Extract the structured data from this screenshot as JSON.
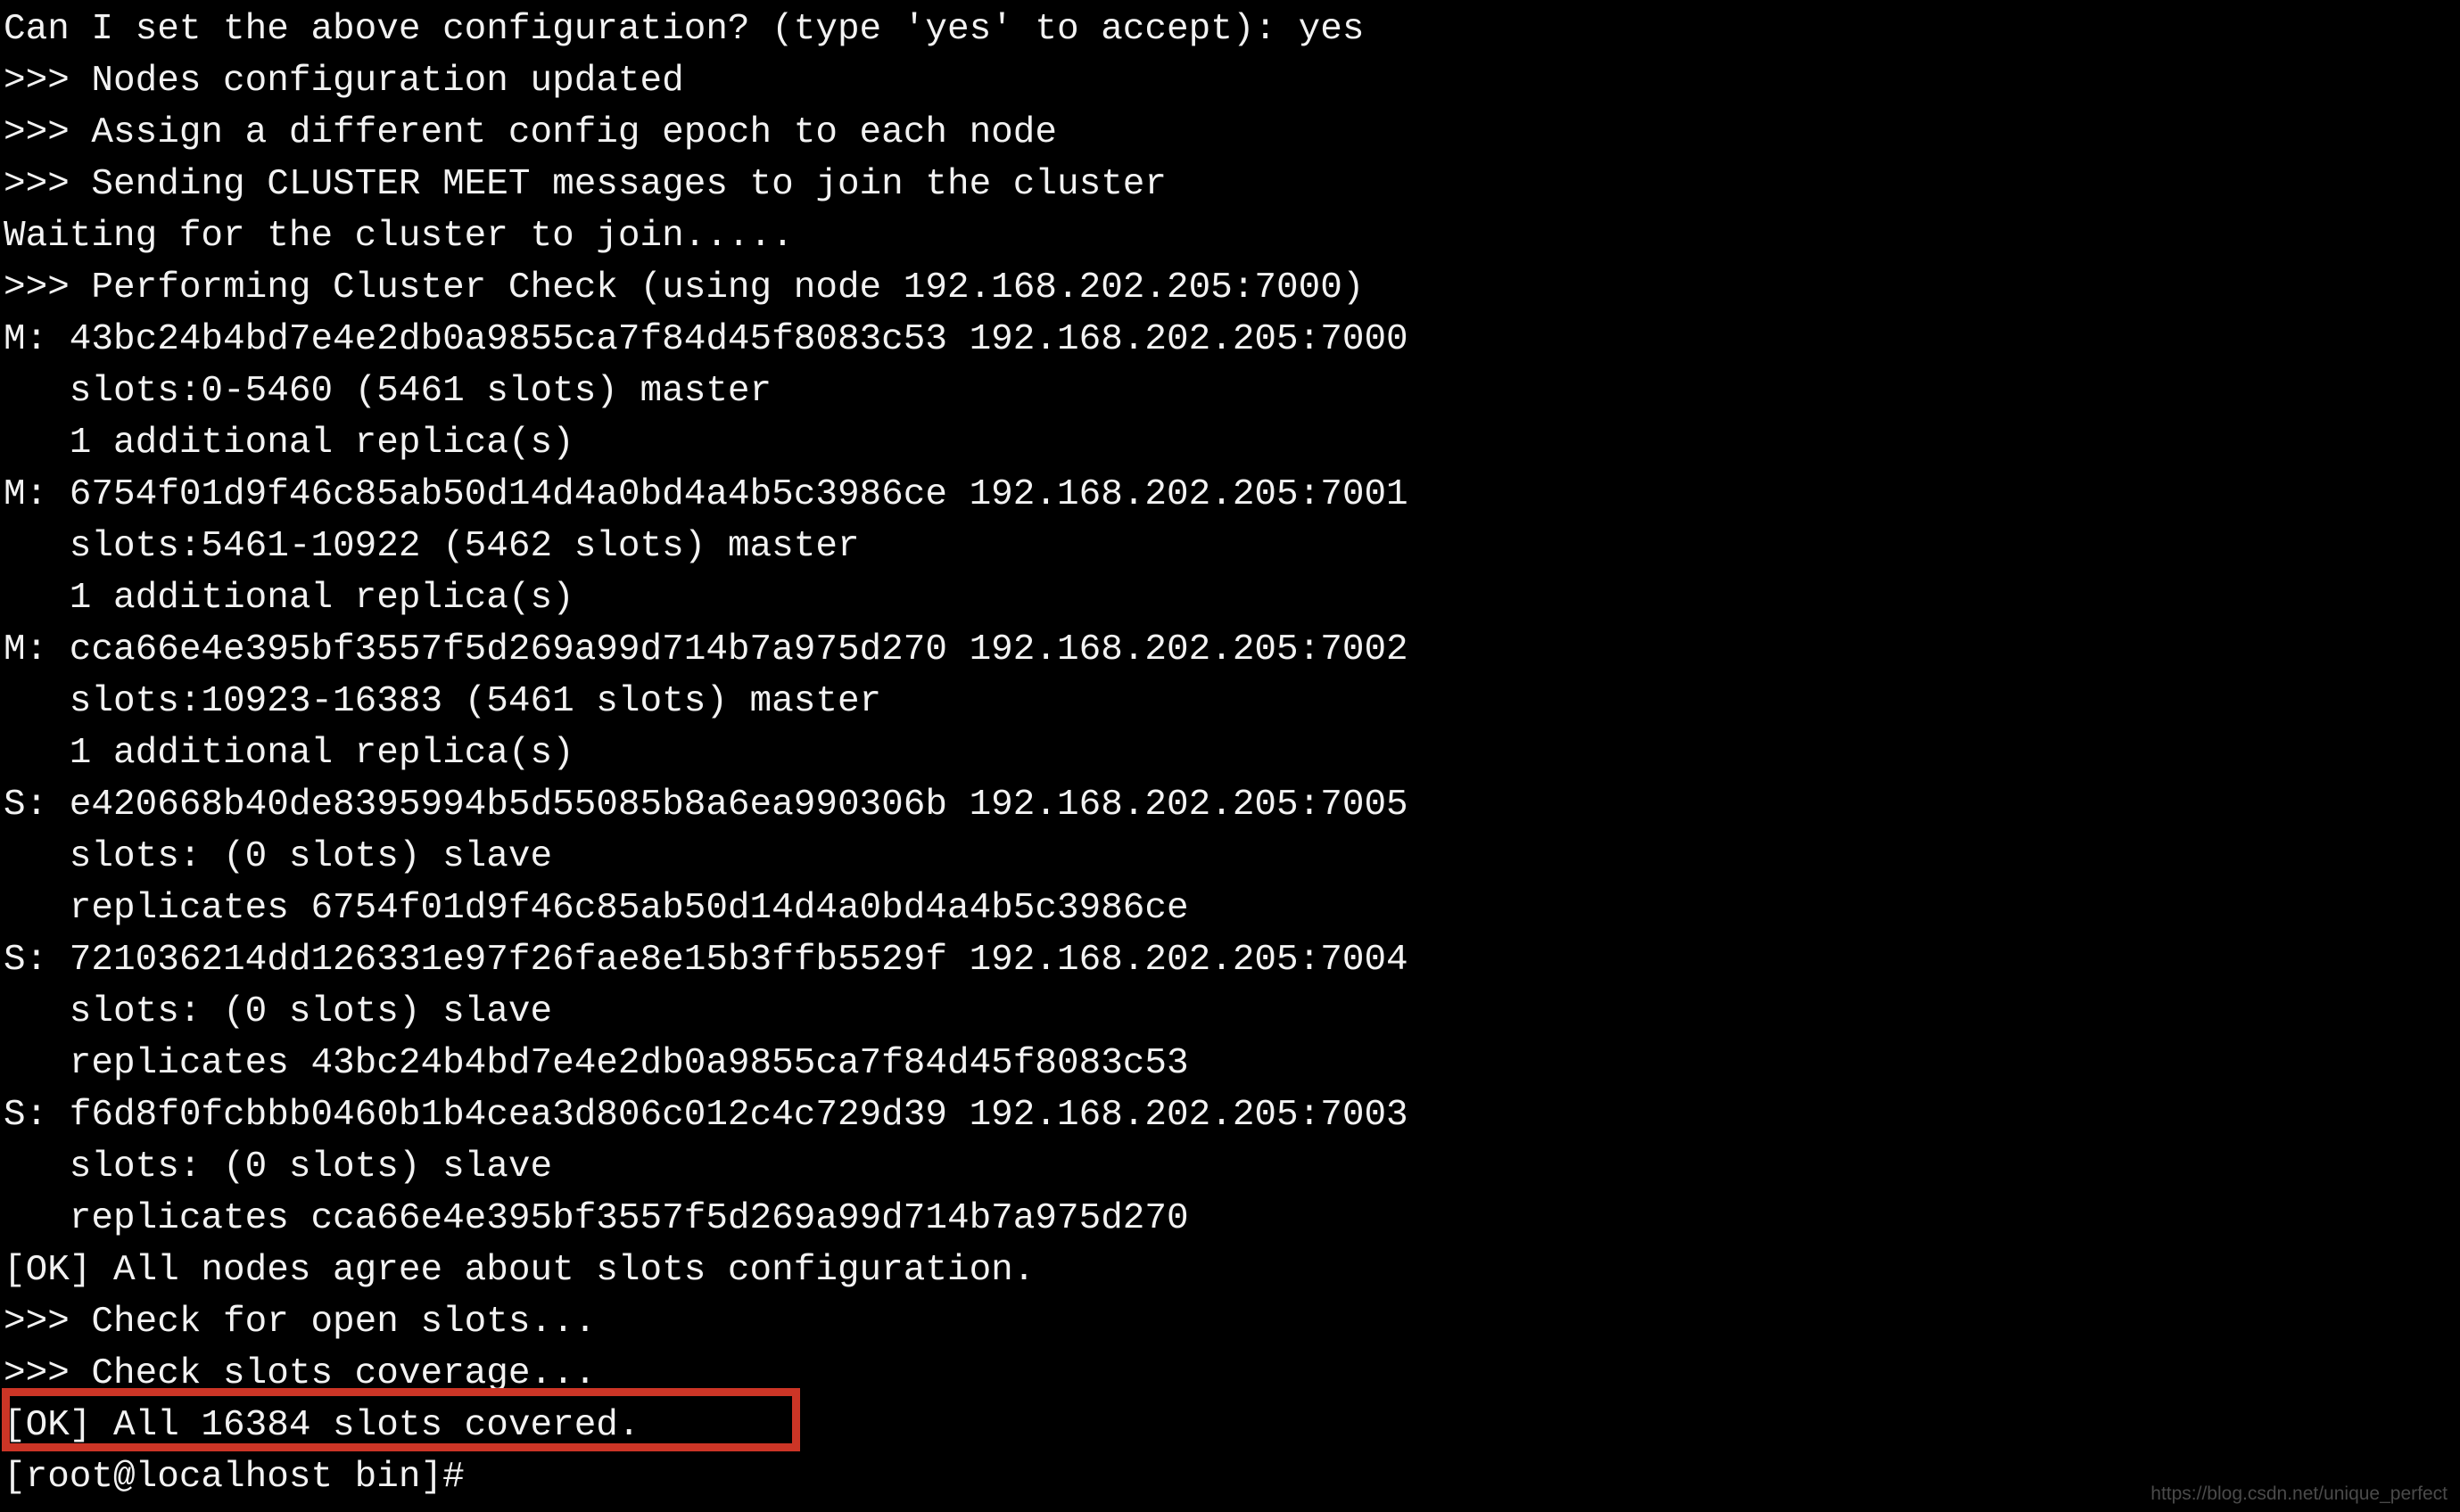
{
  "terminal": {
    "background_color": "#000000",
    "foreground_color": "#f2f2f2",
    "highlight_color": "#cc3526",
    "lines": [
      "Can I set the above configuration? (type 'yes' to accept): yes",
      ">>> Nodes configuration updated",
      ">>> Assign a different config epoch to each node",
      ">>> Sending CLUSTER MEET messages to join the cluster",
      "Waiting for the cluster to join.....",
      ">>> Performing Cluster Check (using node 192.168.202.205:7000)",
      "M: 43bc24b4bd7e4e2db0a9855ca7f84d45f8083c53 192.168.202.205:7000",
      "   slots:0-5460 (5461 slots) master",
      "   1 additional replica(s)",
      "M: 6754f01d9f46c85ab50d14d4a0bd4a4b5c3986ce 192.168.202.205:7001",
      "   slots:5461-10922 (5462 slots) master",
      "   1 additional replica(s)",
      "M: cca66e4e395bf3557f5d269a99d714b7a975d270 192.168.202.205:7002",
      "   slots:10923-16383 (5461 slots) master",
      "   1 additional replica(s)",
      "S: e420668b40de8395994b5d55085b8a6ea990306b 192.168.202.205:7005",
      "   slots: (0 slots) slave",
      "   replicates 6754f01d9f46c85ab50d14d4a0bd4a4b5c3986ce",
      "S: 721036214dd126331e97f26fae8e15b3ffb5529f 192.168.202.205:7004",
      "   slots: (0 slots) slave",
      "   replicates 43bc24b4bd7e4e2db0a9855ca7f84d45f8083c53",
      "S: f6d8f0fcbbb0460b1b4cea3d806c012c4c729d39 192.168.202.205:7003",
      "   slots: (0 slots) slave",
      "   replicates cca66e4e395bf3557f5d269a99d714b7a975d270",
      "[OK] All nodes agree about slots configuration.",
      ">>> Check for open slots...",
      ">>> Check slots coverage...",
      "[OK] All 16384 slots covered.",
      "[root@localhost bin]#"
    ],
    "prompt": "[root@localhost bin]#",
    "highlighted_line": "[OK] All 16384 slots covered."
  },
  "watermark": {
    "text": "https://blog.csdn.net/unique_perfect"
  }
}
